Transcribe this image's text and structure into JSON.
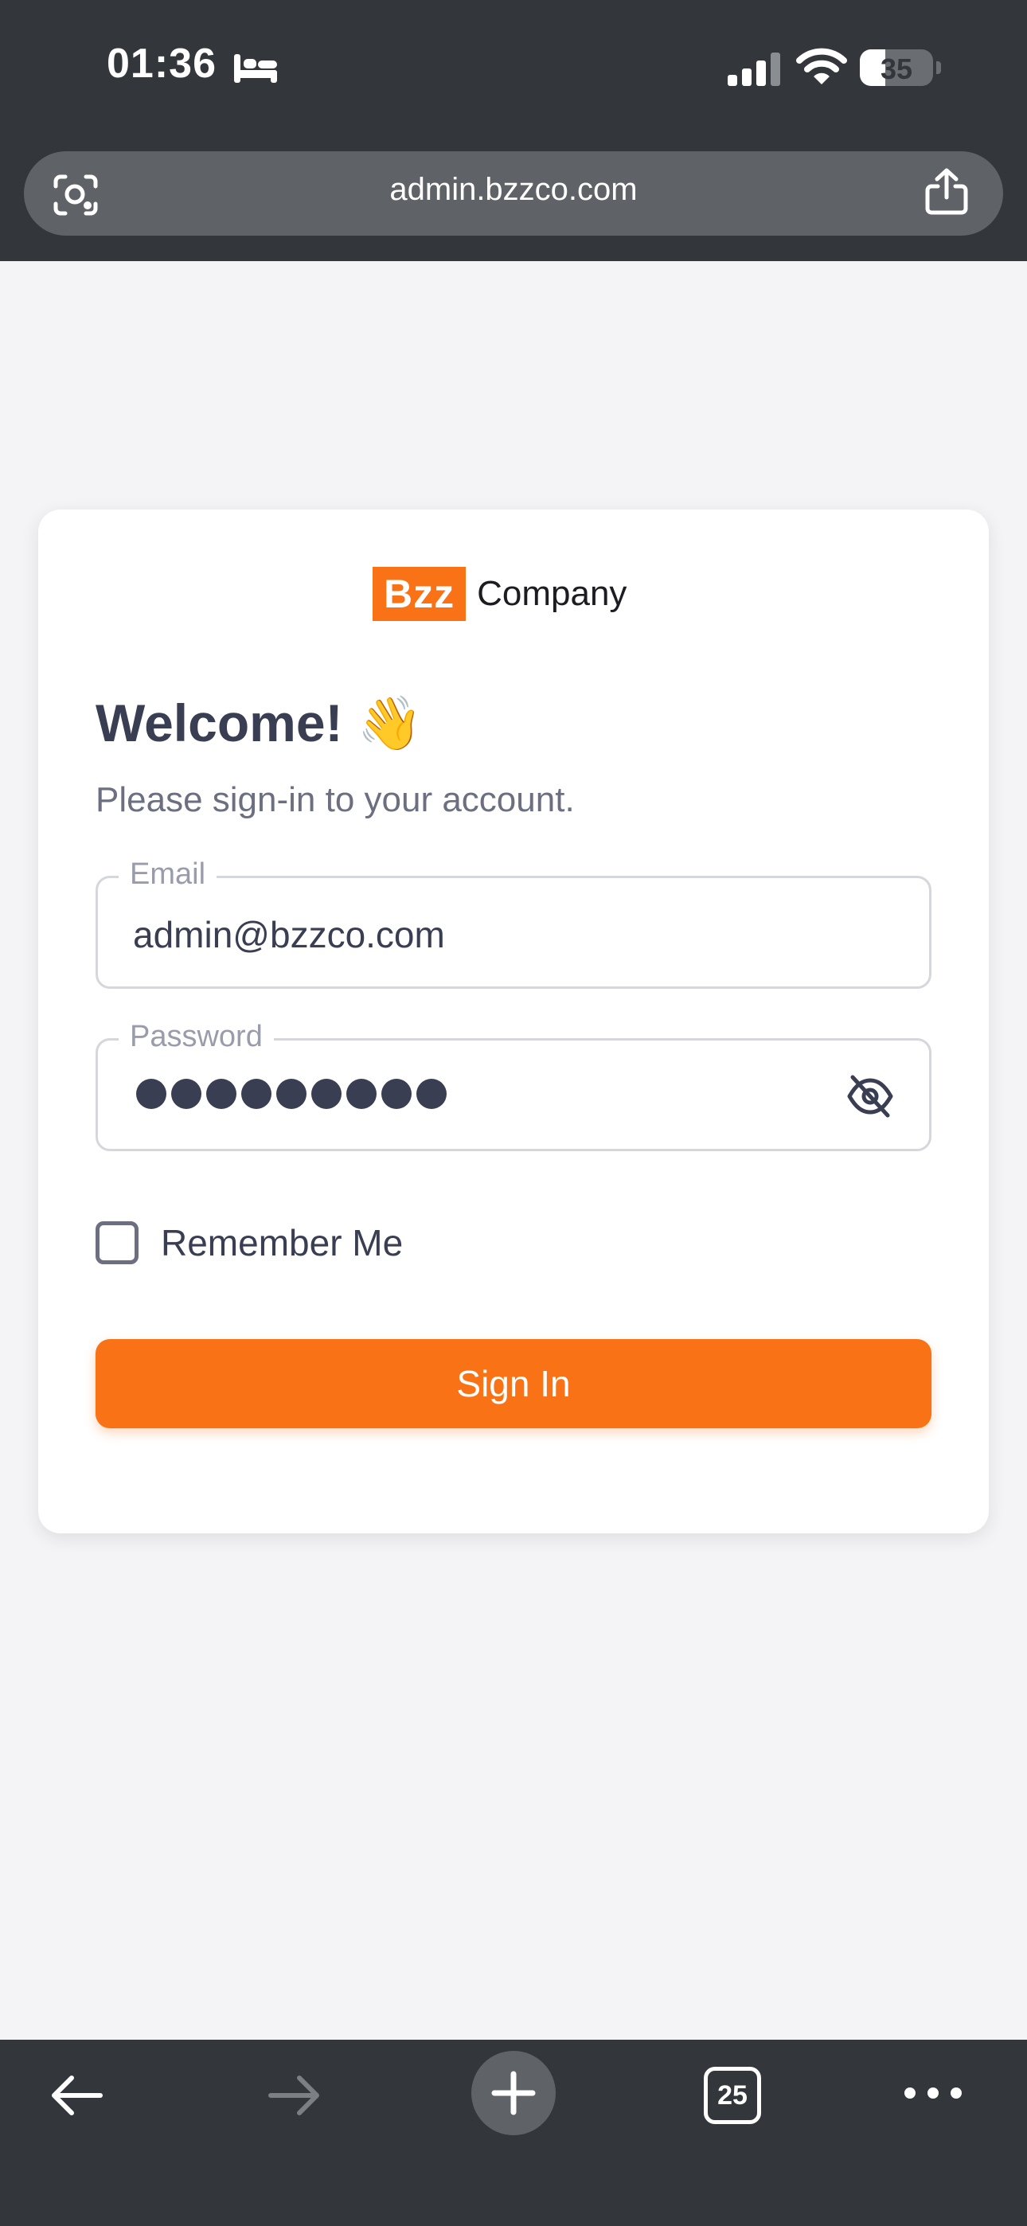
{
  "status_bar": {
    "time": "01:36",
    "battery_level": "35",
    "icons": [
      "bed-icon",
      "cellular-signal-icon",
      "wifi-icon",
      "battery-icon"
    ]
  },
  "browser": {
    "url": "admin.bzzco.com",
    "tab_count": "25",
    "icons": [
      "lens-icon",
      "share-icon",
      "back-arrow-icon",
      "forward-arrow-icon",
      "plus-icon",
      "more-icon"
    ]
  },
  "login": {
    "logo_mark": "Bzz",
    "logo_text": "Company",
    "welcome": "Welcome! 👋",
    "subtitle": "Please sign-in to your account.",
    "email_label": "Email",
    "email_value": "admin@bzzco.com",
    "password_label": "Password",
    "password_length": 9,
    "remember_label": "Remember Me",
    "remember_checked": false,
    "signin_label": "Sign In"
  },
  "colors": {
    "brand_orange": "#f97316",
    "chrome_dark": "#33363b",
    "text_dark": "#3a3e52",
    "page_bg": "#f4f4f6"
  }
}
